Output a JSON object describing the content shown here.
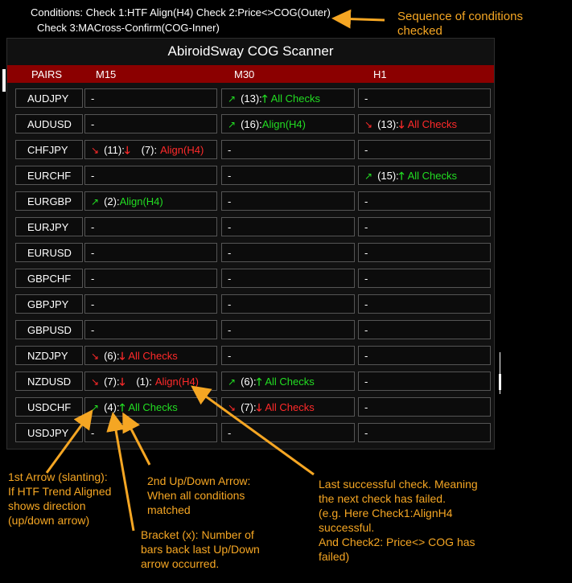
{
  "top": {
    "line1": "Conditions:   Check 1:HTF Align(H4)   Check 2:Price<>COG(Outer)",
    "line2": "Check 3:MACross-Confirm(COG-Inner)",
    "sequence_note": "Sequence of conditions checked"
  },
  "panel": {
    "title": "AbiroidSway COG Scanner",
    "headers": [
      "PAIRS",
      "M15",
      "M30",
      "H1"
    ]
  },
  "rows": [
    {
      "pair": "AUDJPY",
      "m15": {
        "text": "-"
      },
      "m30": {
        "slant": "↗",
        "count": "(13):",
        "big": "🡑",
        "label": "All Checks",
        "color": "green"
      },
      "h1": {
        "text": "-"
      }
    },
    {
      "pair": "AUDUSD",
      "m15": {
        "text": "-"
      },
      "m30": {
        "slant": "↗",
        "count": "(16):",
        "big": "",
        "label": "Align(H4)",
        "color": "green"
      },
      "h1": {
        "slant": "↘",
        "count": "(13):",
        "big": "🡓",
        "label": "All Checks",
        "color": "red"
      }
    },
    {
      "pair": "CHFJPY",
      "m15": {
        "slant": "↘",
        "count": "(11):",
        "big": "🡓",
        "count2": "(7):",
        "label": "Align(H4)",
        "color": "red"
      },
      "m30": {
        "text": "-"
      },
      "h1": {
        "text": "-"
      }
    },
    {
      "pair": "EURCHF",
      "m15": {
        "text": "-"
      },
      "m30": {
        "text": "-"
      },
      "h1": {
        "slant": "↗",
        "count": "(15):",
        "big": "🡑",
        "label": "All Checks",
        "color": "green"
      }
    },
    {
      "pair": "EURGBP",
      "m15": {
        "slant": "↗",
        "count": "(2):",
        "big": "",
        "label": "Align(H4)",
        "color": "green"
      },
      "m30": {
        "text": "-"
      },
      "h1": {
        "text": "-"
      }
    },
    {
      "pair": "EURJPY",
      "m15": {
        "text": "-"
      },
      "m30": {
        "text": "-"
      },
      "h1": {
        "text": "-"
      }
    },
    {
      "pair": "EURUSD",
      "m15": {
        "text": "-"
      },
      "m30": {
        "text": "-"
      },
      "h1": {
        "text": "-"
      }
    },
    {
      "pair": "GBPCHF",
      "m15": {
        "text": "-"
      },
      "m30": {
        "text": "-"
      },
      "h1": {
        "text": "-"
      }
    },
    {
      "pair": "GBPJPY",
      "m15": {
        "text": "-"
      },
      "m30": {
        "text": "-"
      },
      "h1": {
        "text": "-"
      }
    },
    {
      "pair": "GBPUSD",
      "m15": {
        "text": "-"
      },
      "m30": {
        "text": "-"
      },
      "h1": {
        "text": "-"
      }
    },
    {
      "pair": "NZDJPY",
      "m15": {
        "slant": "↘",
        "count": "(6):",
        "big": "🡓",
        "label": "All Checks",
        "color": "red"
      },
      "m30": {
        "text": "-"
      },
      "h1": {
        "text": "-"
      }
    },
    {
      "pair": "NZDUSD",
      "m15": {
        "slant": "↘",
        "count": "(7):",
        "big": "🡓",
        "count2": "(1):",
        "label": "Align(H4)",
        "color": "red"
      },
      "m30": {
        "slant": "↗",
        "count": "(6):",
        "big": "🡑",
        "label": "All Checks",
        "color": "green"
      },
      "h1": {
        "text": "-"
      }
    },
    {
      "pair": "USDCHF",
      "m15": {
        "slant": "↗",
        "count": "(4):",
        "big": "🡑",
        "label": "All Checks",
        "color": "green"
      },
      "m30": {
        "slant": "↘",
        "count": "(7):",
        "big": "🡓",
        "label": "All Checks",
        "color": "red"
      },
      "h1": {
        "text": "-"
      }
    },
    {
      "pair": "USDJPY",
      "m15": {
        "text": "-"
      },
      "m30": {
        "text": "-"
      },
      "h1": {
        "text": "-"
      }
    }
  ],
  "annotations": {
    "first_arrow": "1st Arrow (slanting):\nIf HTF Trend Aligned\nshows direction\n(up/down arrow)",
    "bracket": "Bracket (x): Number of\nbars back last Up/Down\narrow occurred.",
    "second_arrow": "2nd Up/Down Arrow:\nWhen all conditions\nmatched",
    "last_check": "Last successful check. Meaning\nthe next check has failed.\n(e.g. Here Check1:AlignH4\nsuccessful.\nAnd Check2: Price<> COG has\nfailed)"
  },
  "colors": {
    "green": "#22dd22",
    "red": "#ff2a2a",
    "header": "#8b0000",
    "note": "#f5a623"
  }
}
